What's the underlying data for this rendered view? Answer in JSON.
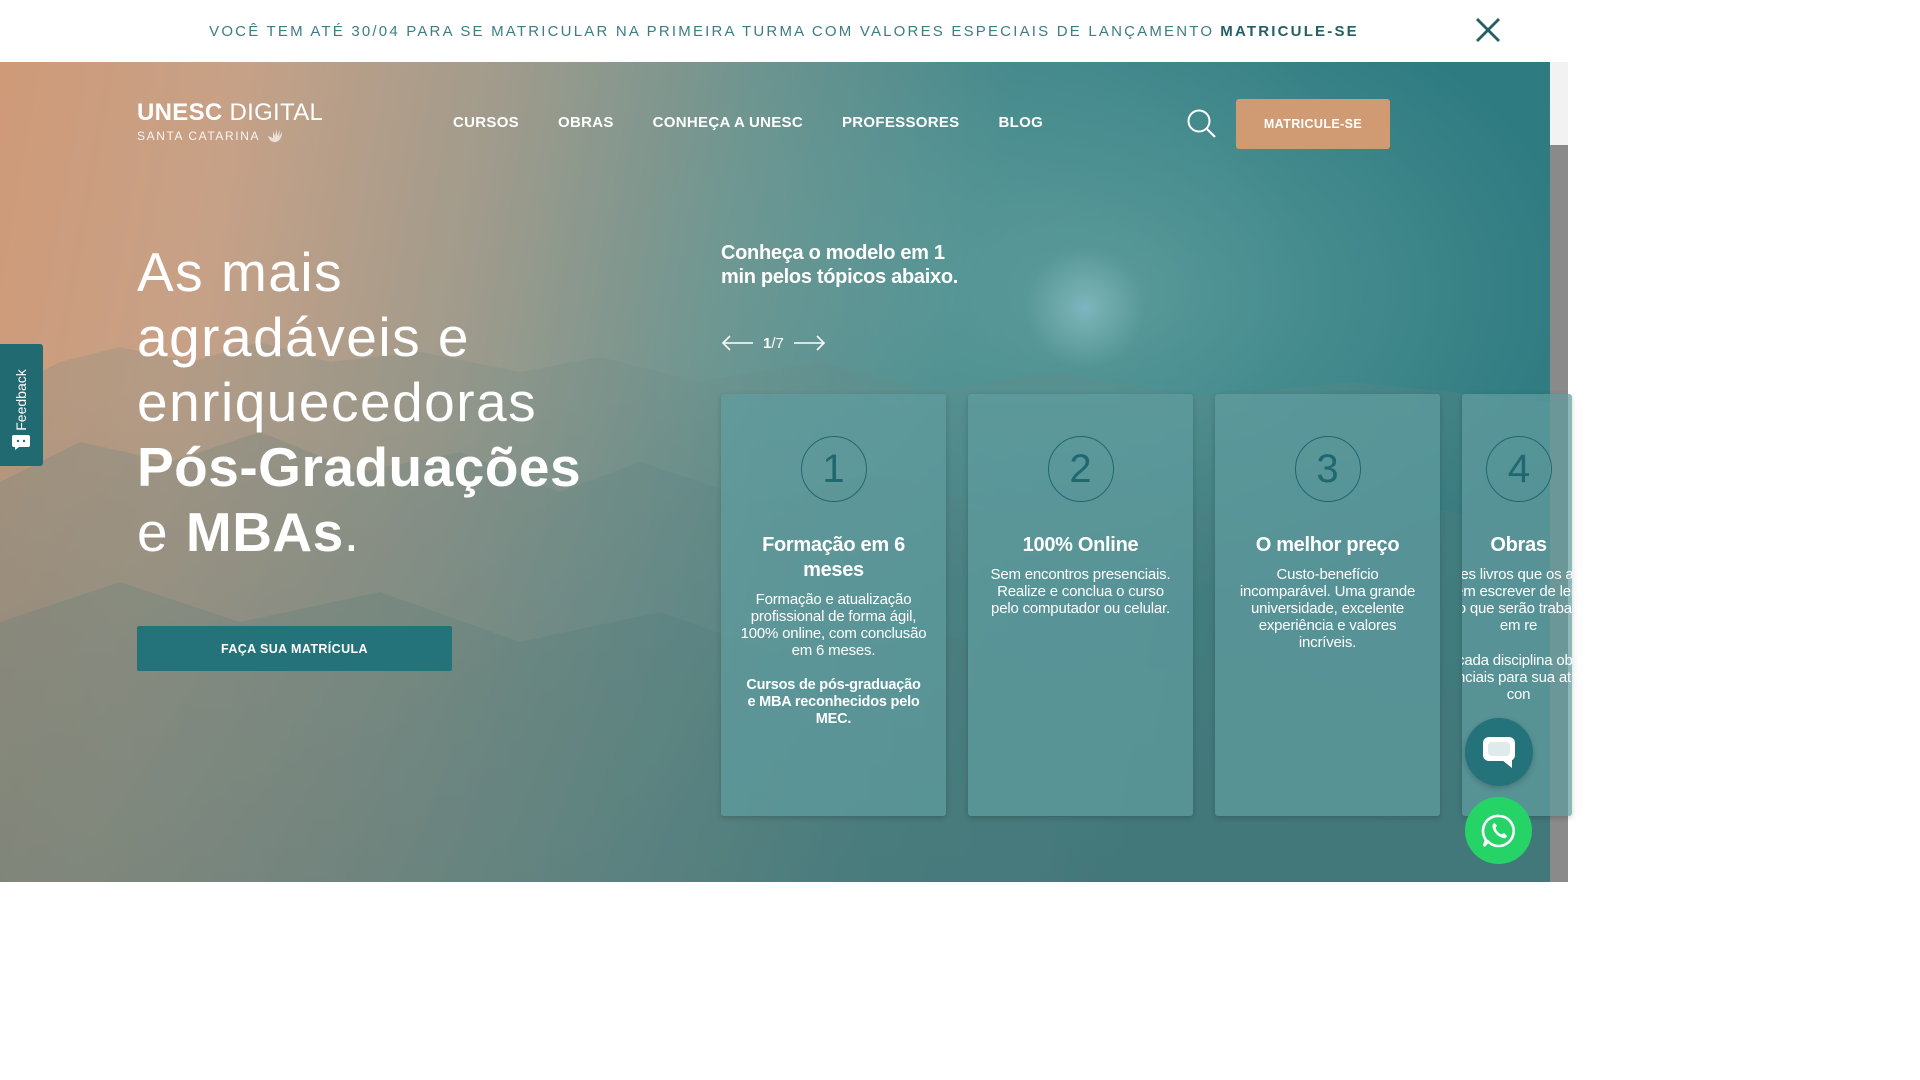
{
  "announcement": {
    "text": "VOCÊ TEM ATÉ 30/04 PARA SE MATRICULAR NA PRIMEIRA TURMA COM VALORES ESPECIAIS DE LANÇAMENTO",
    "link_label": "MATRICULE-SE",
    "close_icon": "close-icon"
  },
  "logo": {
    "brand_bold": "UNESC",
    "brand_light": " DIGITAL",
    "subtitle": "SANTA CATARINA"
  },
  "nav": {
    "items": [
      {
        "label": "CURSOS"
      },
      {
        "label": "OBRAS"
      },
      {
        "label": "CONHEÇA A UNESC"
      },
      {
        "label": "PROFESSORES"
      },
      {
        "label": "BLOG"
      }
    ],
    "search_icon": "search-icon",
    "cta_label": "MATRICULE-SE"
  },
  "hero": {
    "line1": "As mais",
    "line2": "agradáveis e",
    "line3": "enriquecedoras",
    "line4_bold": "Pós-Graduações",
    "line5_pre": "e ",
    "line5_bold": "MBAs",
    "line5_post": ".",
    "cta_label": "FAÇA SUA MATRÍCULA"
  },
  "slider": {
    "title": "Conheça o modelo em 1 min pelos tópicos abaixo.",
    "current": "1",
    "total": "/7",
    "cards": [
      {
        "number": "1",
        "title": "Formação em 6 meses",
        "description": "Formação e atualização profissional de forma ágil, 100% online, com conclusão em 6 meses.",
        "note": "Cursos de pós-graduação e MBA reconhecidos pelo MEC."
      },
      {
        "number": "2",
        "title": "100% Online",
        "description": "Sem encontros presenciais. Realize e conclua o curso pelo computador ou celular."
      },
      {
        "number": "3",
        "title": "O melhor preço",
        "description": "Custo-benefício incomparável. Uma grande universidade, excelente experiência e valores incríveis."
      },
      {
        "number": "4",
        "title": "Obras",
        "description": "Aqueles livros que os autores querem escrever de leitura e estudo que serão trabalhados em re",
        "note": "A cada disciplina obras essenciais para sua atuação con"
      }
    ]
  },
  "feedback": {
    "label": "Feedback"
  },
  "floating": {
    "chat_icon": "chat-bubble-icon",
    "whatsapp_icon": "whatsapp-icon"
  }
}
